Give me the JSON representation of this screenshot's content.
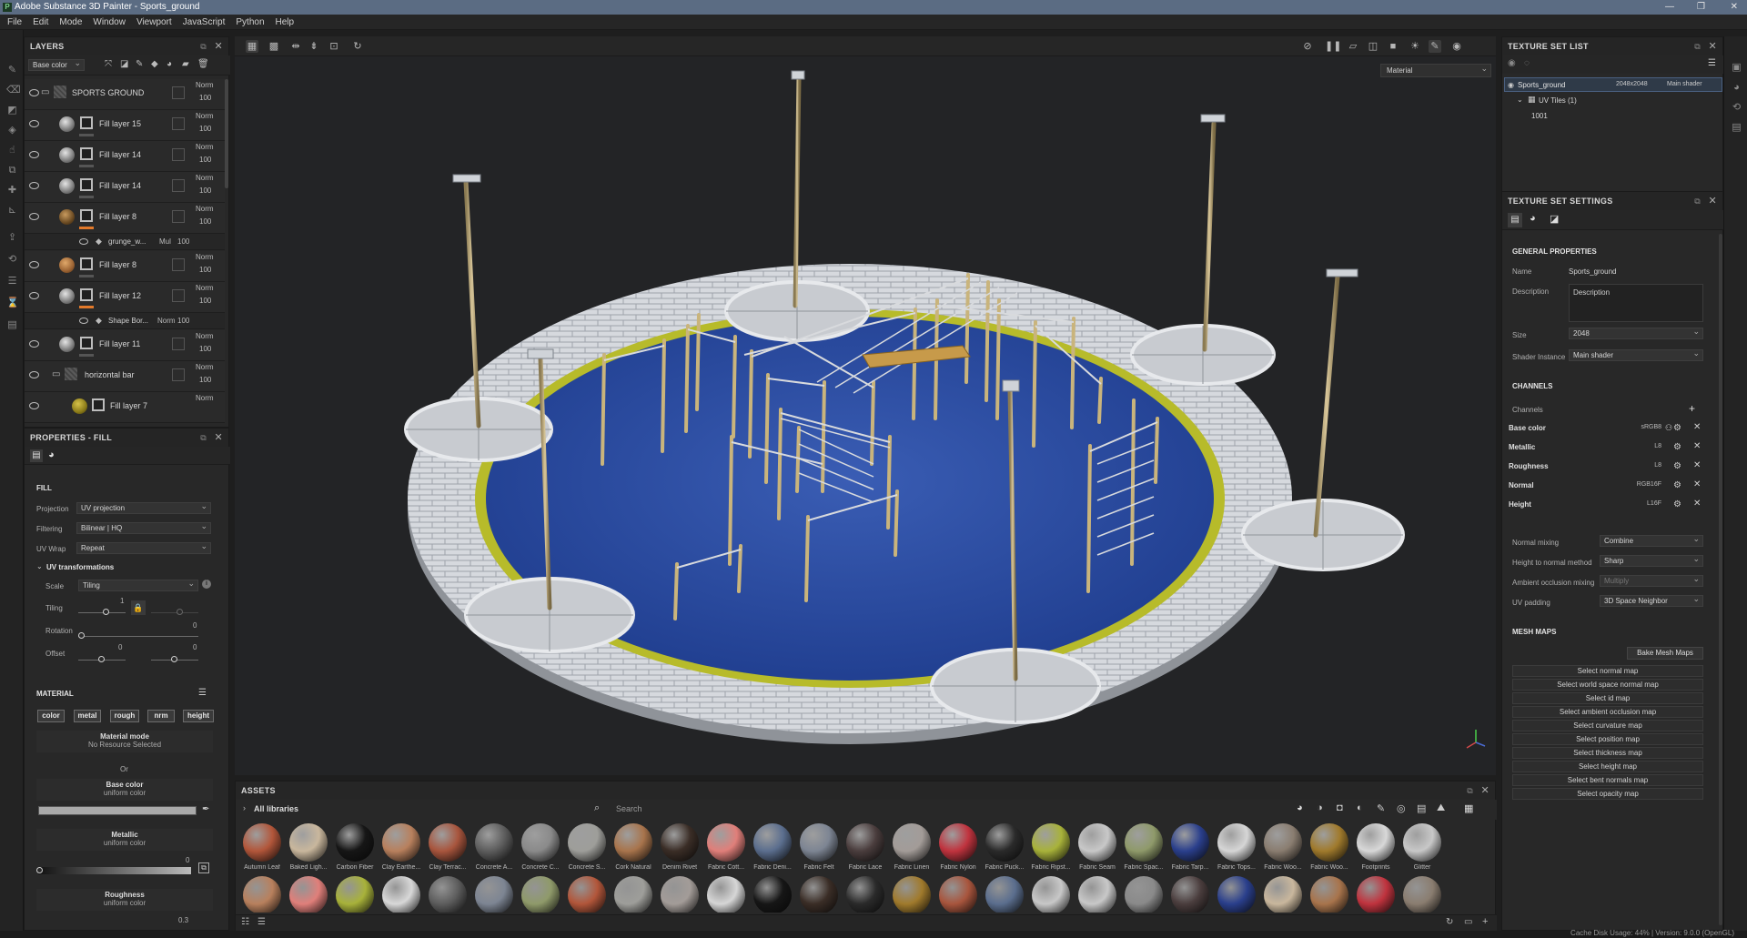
{
  "app": {
    "title": "Adobe Substance 3D Painter - Sports_ground",
    "menu": [
      "File",
      "Edit",
      "Mode",
      "Window",
      "Viewport",
      "JavaScript",
      "Python",
      "Help"
    ]
  },
  "layers": {
    "panel_title": "LAYERS",
    "channel_select": "Base color",
    "rows": [
      {
        "name": "SPORTS GROUND",
        "blend": "Norm",
        "opacity": "100"
      },
      {
        "name": "Fill layer 15",
        "blend": "Norm",
        "opacity": "100"
      },
      {
        "name": "Fill layer 14",
        "blend": "Norm",
        "opacity": "100"
      },
      {
        "name": "Fill layer 14",
        "blend": "Norm",
        "opacity": "100"
      },
      {
        "name": "Fill layer 8",
        "blend": "Norm",
        "opacity": "100"
      },
      {
        "name": "Fill layer 8",
        "blend": "Norm",
        "opacity": "100"
      },
      {
        "name": "Fill layer 12",
        "blend": "Norm",
        "opacity": "100"
      },
      {
        "name": "Fill layer 11",
        "blend": "Norm",
        "opacity": "100"
      },
      {
        "name": "horizontal bar",
        "blend": "Norm",
        "opacity": "100"
      },
      {
        "name": "Fill layer 7",
        "blend": "Norm",
        "opacity": ""
      }
    ],
    "subrows": [
      {
        "name": "grunge_w...",
        "blend": "Mul",
        "opacity": "100"
      },
      {
        "name": "Shape Bor...",
        "blend": "Norm",
        "opacity": "100"
      }
    ]
  },
  "properties": {
    "panel_title": "PROPERTIES - FILL",
    "fill_heading": "FILL",
    "projection_label": "Projection",
    "projection_value": "UV projection",
    "filtering_label": "Filtering",
    "filtering_value": "Bilinear | HQ",
    "uvwrap_label": "UV Wrap",
    "uvwrap_value": "Repeat",
    "uvtrans_heading": "UV transformations",
    "scale_label": "Scale",
    "scale_value": "Tiling",
    "tiling_label": "Tiling",
    "tiling_value": "1",
    "rotation_label": "Rotation",
    "rotation_value": "0",
    "offset_label": "Offset",
    "offset_value_a": "0",
    "offset_value_b": "0",
    "material_heading": "MATERIAL",
    "chips": [
      "color",
      "metal",
      "rough",
      "nrm",
      "height"
    ],
    "material_mode_title": "Material mode",
    "material_mode_sub": "No Resource Selected",
    "or_label": "Or",
    "base_color_title": "Base color",
    "base_color_sub": "uniform color",
    "metallic_title": "Metallic",
    "metallic_sub": "uniform color",
    "metallic_value": "0",
    "roughness_title": "Roughness",
    "roughness_sub": "uniform color",
    "roughness_value": "0.3"
  },
  "viewport": {
    "material_select": "Material"
  },
  "assets": {
    "panel_title": "ASSETS",
    "library": "All libraries",
    "search_placeholder": "Search",
    "items": [
      {
        "name": "Autumn Leaf",
        "color": "#b2563a"
      },
      {
        "name": "Baked Ligh...",
        "color": "#c9b79d"
      },
      {
        "name": "Carbon Fiber",
        "color": "#161616"
      },
      {
        "name": "Clay Earthe...",
        "color": "#b8805d"
      },
      {
        "name": "Clay Terrac...",
        "color": "#a8553d"
      },
      {
        "name": "Concrete A...",
        "color": "#5d5d5d"
      },
      {
        "name": "Concrete C...",
        "color": "#8a8a8a"
      },
      {
        "name": "Concrete S...",
        "color": "#9e9e9a"
      },
      {
        "name": "Cork Natural",
        "color": "#a8744c"
      },
      {
        "name": "Denim Rivet",
        "color": "#3a2d26"
      },
      {
        "name": "Fabric Cott...",
        "color": "#e07f7a"
      },
      {
        "name": "Fabric Deni...",
        "color": "#5b6e8e"
      },
      {
        "name": "Fabric Felt",
        "color": "#7d8593"
      },
      {
        "name": "Fabric Lace",
        "color": "#4a3d3d"
      },
      {
        "name": "Fabric Linen",
        "color": "#a39c98"
      },
      {
        "name": "Fabric Nylon",
        "color": "#c0333e"
      },
      {
        "name": "Fabric Puck...",
        "color": "#2a2a2a"
      },
      {
        "name": "Fabric Ripst...",
        "color": "#a8b23a"
      },
      {
        "name": "Fabric Seam",
        "color": "#c8c8c8"
      },
      {
        "name": "Fabric Spac...",
        "color": "#8f9a6a"
      },
      {
        "name": "Fabric Tarp...",
        "color": "#2a3f8c"
      },
      {
        "name": "Fabric Tops...",
        "color": "#d6d6d6"
      },
      {
        "name": "Fabric Woo...",
        "color": "#8a7d70"
      },
      {
        "name": "Fabric Woo...",
        "color": "#a07a2c"
      },
      {
        "name": "Footprints",
        "color": "#d8d8d8"
      },
      {
        "name": "Glitter",
        "color": "#c8c8c8"
      }
    ]
  },
  "texture_set_list": {
    "panel_title": "TEXTURE SET LIST",
    "set_name": "Sports_ground",
    "set_res": "2048x2048",
    "set_shader": "Main shader",
    "uv_tiles": "UV Tiles (1)",
    "tile_id": "1001"
  },
  "texture_set_settings": {
    "panel_title": "TEXTURE SET SETTINGS",
    "general_heading": "GENERAL PROPERTIES",
    "name_label": "Name",
    "name_value": "Sports_ground",
    "desc_label": "Description",
    "desc_placeholder": "Description",
    "size_label": "Size",
    "size_value": "2048",
    "shader_label": "Shader Instance",
    "shader_value": "Main shader",
    "channels_heading": "CHANNELS",
    "channels_label": "Channels",
    "channels": [
      {
        "name": "Base color",
        "format": "sRGB8"
      },
      {
        "name": "Metallic",
        "format": "L8"
      },
      {
        "name": "Roughness",
        "format": "L8"
      },
      {
        "name": "Normal",
        "format": "RGB16F"
      },
      {
        "name": "Height",
        "format": "L16F"
      }
    ],
    "normal_mixing_label": "Normal mixing",
    "normal_mixing_value": "Combine",
    "h2n_label": "Height to normal method",
    "h2n_value": "Sharp",
    "ao_label": "Ambient occlusion mixing",
    "ao_value": "Multiply",
    "uvpad_label": "UV padding",
    "uvpad_value": "3D Space Neighbor",
    "mesh_heading": "MESH MAPS",
    "bake_button": "Bake Mesh Maps",
    "mesh_maps": [
      "Select normal map",
      "Select world space normal map",
      "Select id map",
      "Select ambient occlusion map",
      "Select curvature map",
      "Select position map",
      "Select thickness map",
      "Select height map",
      "Select bent normals map",
      "Select opacity map"
    ]
  },
  "status": {
    "text": "Cache Disk Usage:   44% | Version: 9.0.0 (OpenGL)"
  }
}
